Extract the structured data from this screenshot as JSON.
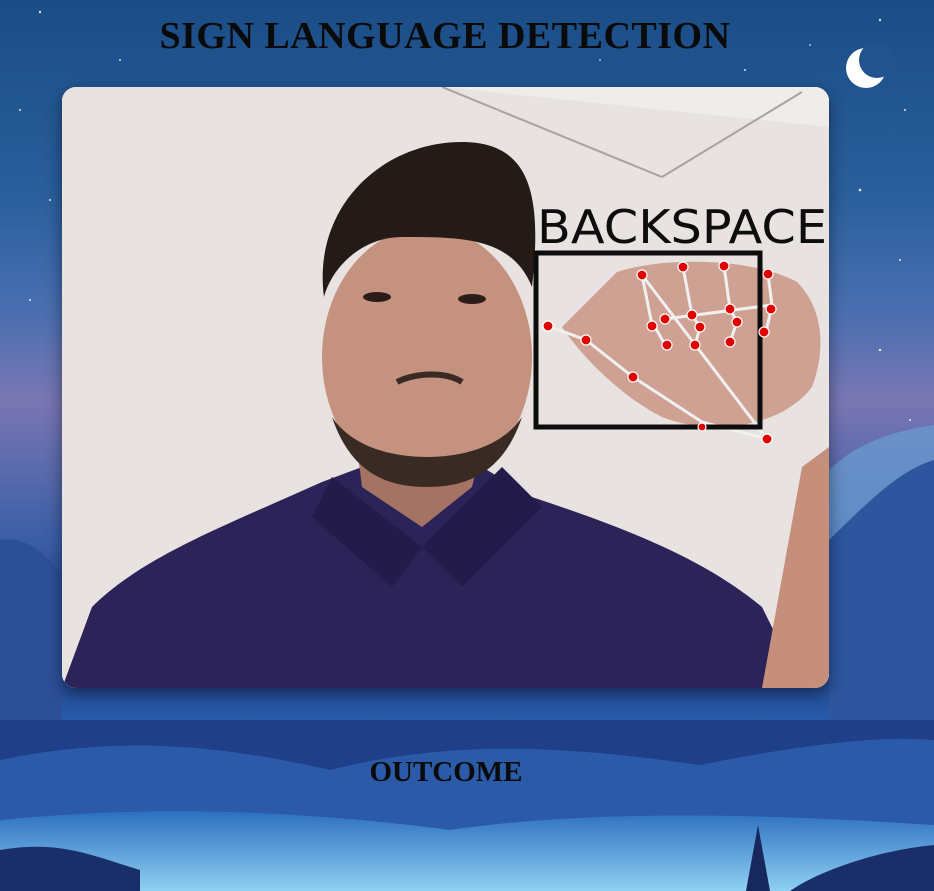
{
  "header": {
    "title": "SIGN LANGUAGE DETECTION"
  },
  "video": {
    "detected_label": "BACKSPACE"
  },
  "outcome": {
    "label": "OUTCOME"
  },
  "colors": {
    "landmark": "#e00000",
    "box": "#0d0d0d",
    "connector": "#eeeeee"
  }
}
